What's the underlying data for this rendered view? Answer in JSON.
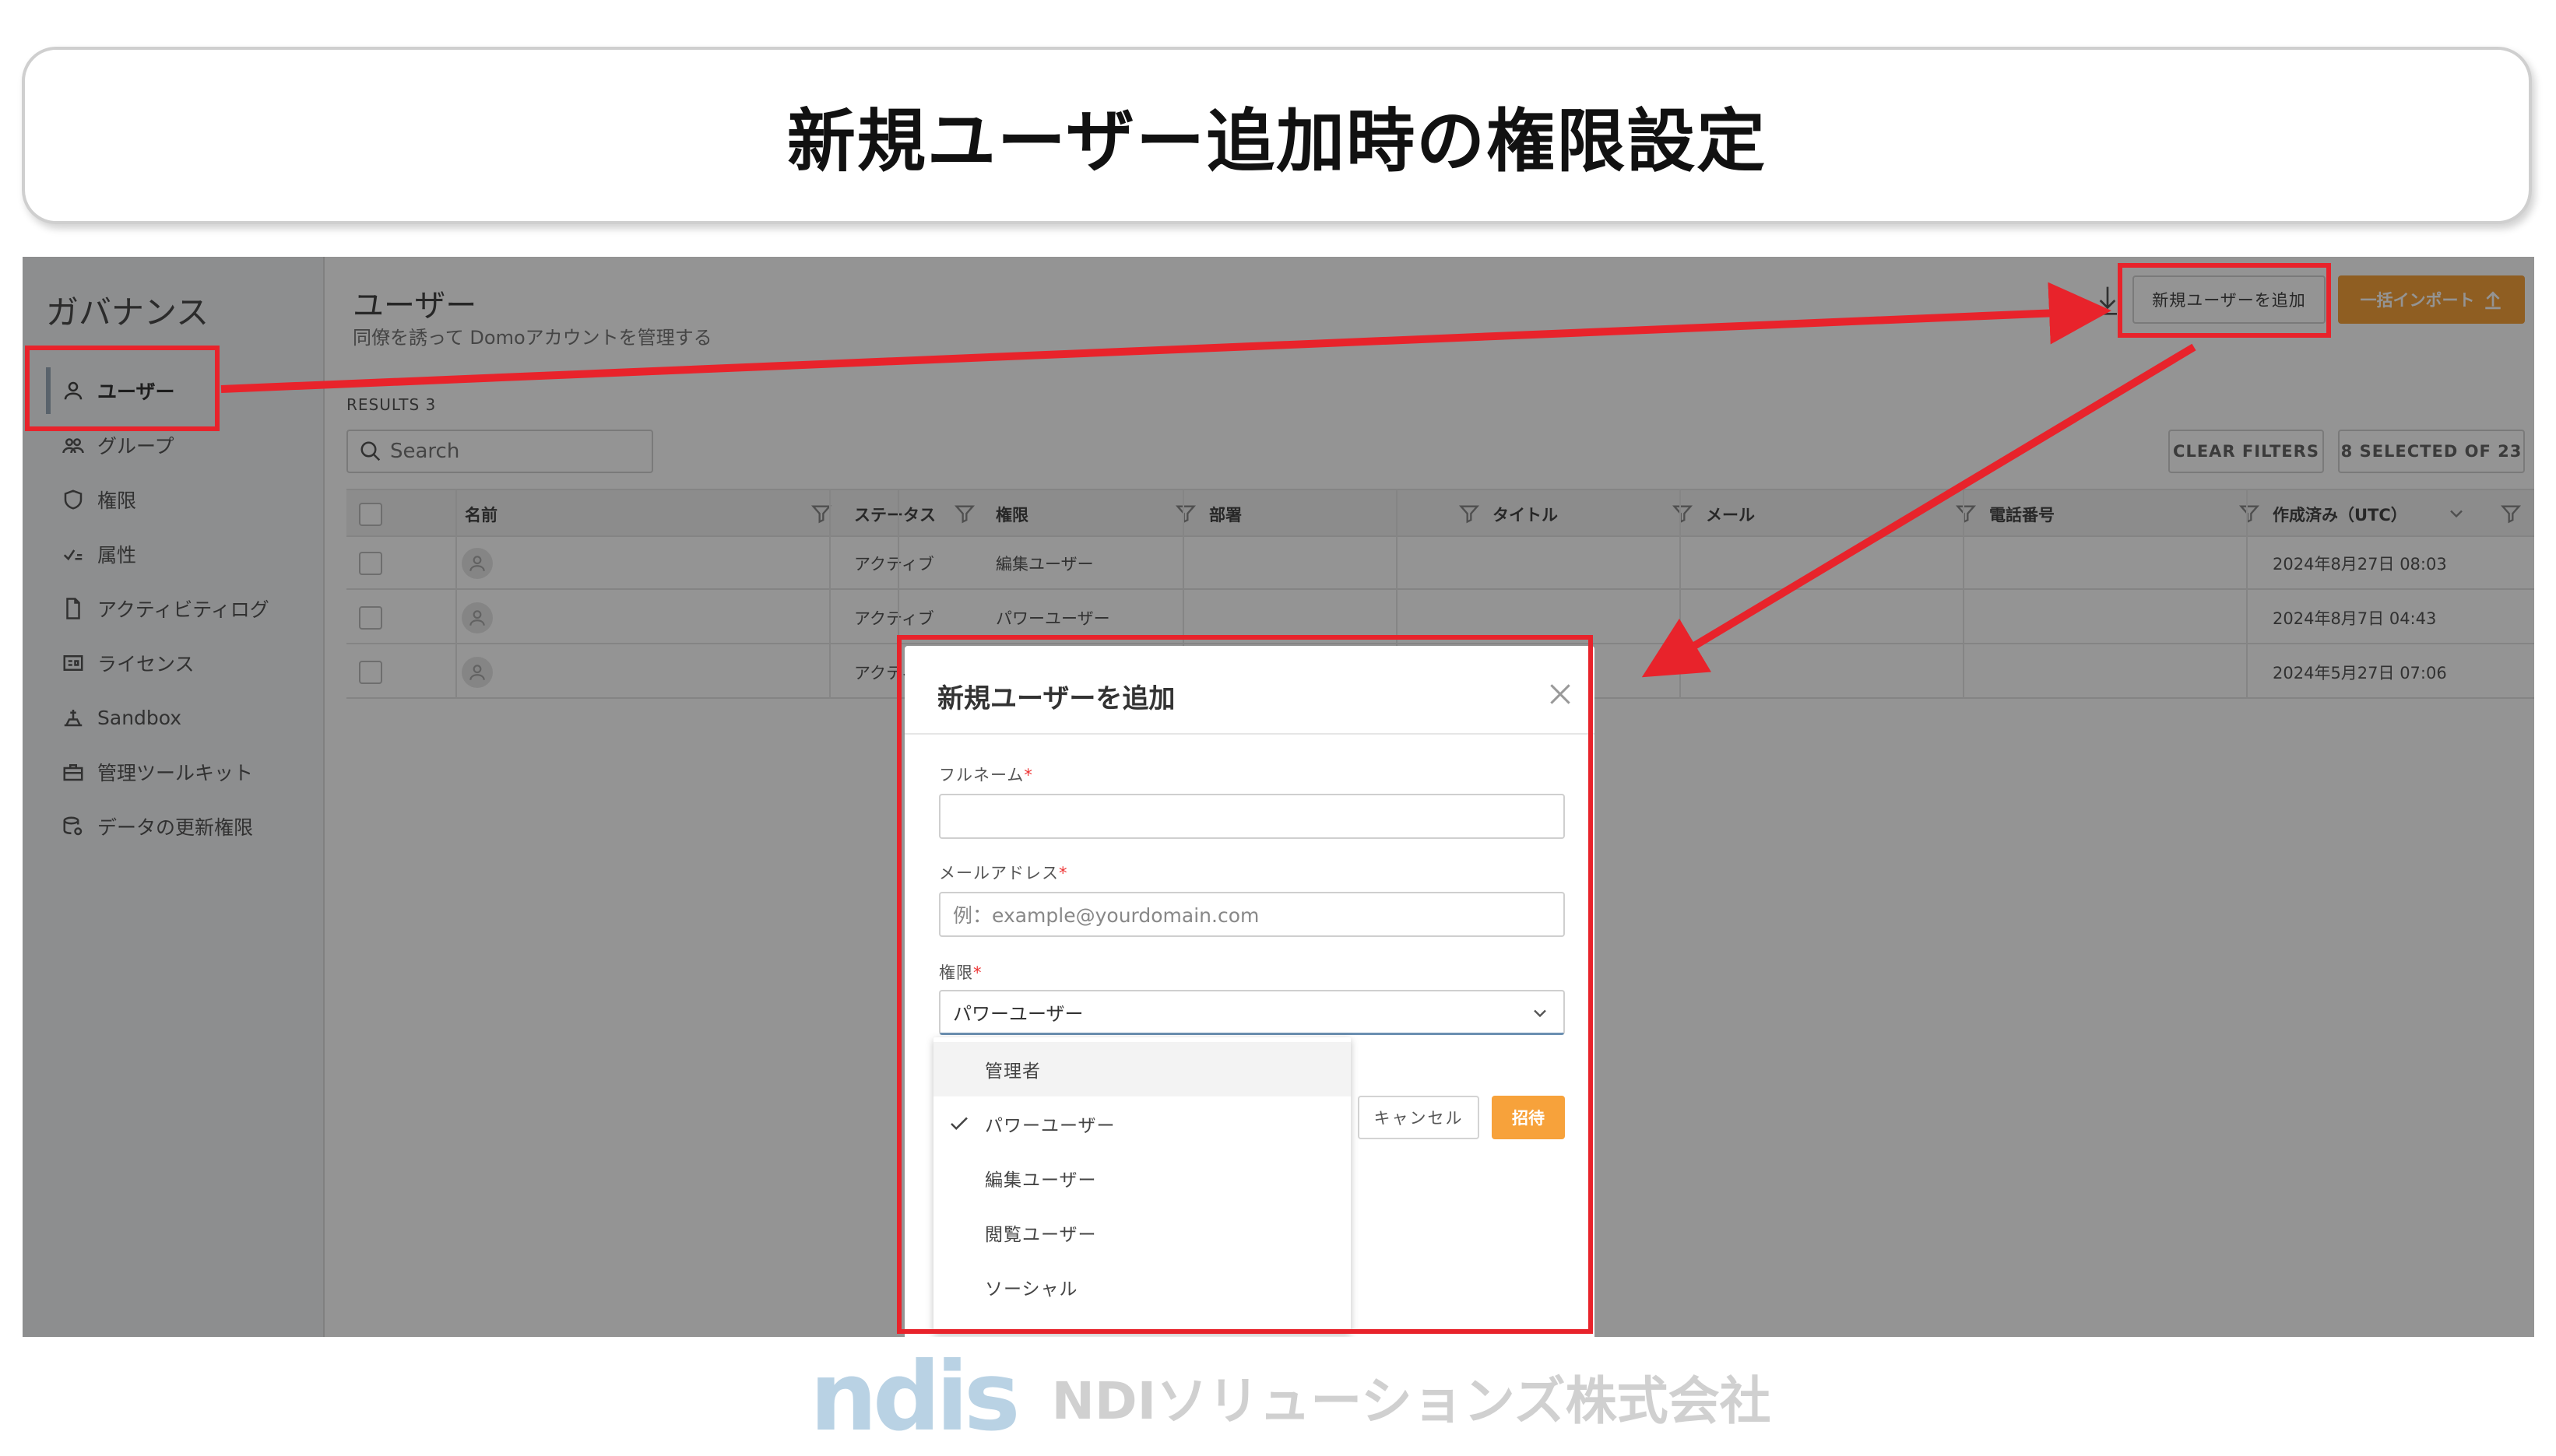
{
  "slide": {
    "title": "新規ユーザー追加時の権限設定",
    "footer_logo": "ndis",
    "footer_company": "NDIソリューションズ株式会社"
  },
  "sidebar": {
    "title": "ガバナンス",
    "items": [
      {
        "label": "ユーザー",
        "icon": "user-icon",
        "active": true
      },
      {
        "label": "グループ",
        "icon": "group-icon",
        "active": false
      },
      {
        "label": "権限",
        "icon": "shield-icon",
        "active": false
      },
      {
        "label": "属性",
        "icon": "attribute-icon",
        "active": false
      },
      {
        "label": "アクティビティログ",
        "icon": "document-icon",
        "active": false
      },
      {
        "label": "ライセンス",
        "icon": "license-icon",
        "active": false
      },
      {
        "label": "Sandbox",
        "icon": "sandbox-icon",
        "active": false
      },
      {
        "label": "管理ツールキット",
        "icon": "toolkit-icon",
        "active": false
      },
      {
        "label": "データの更新権限",
        "icon": "data-permission-icon",
        "active": false
      }
    ]
  },
  "main": {
    "title": "ユーザー",
    "subtitle": "同僚を誘って Domoアカウントを管理する",
    "results_label": "RESULTS 3",
    "search_placeholder": "Search",
    "add_user_button": "新規ユーザーを追加",
    "bulk_import_button": "一括インポート",
    "clear_filters": "CLEAR FILTERS",
    "selected_columns": "8 SELECTED OF 23"
  },
  "table": {
    "columns": [
      "名前",
      "ステータス",
      "権限",
      "部署",
      "タイトル",
      "メール",
      "電話番号",
      "作成済み（UTC）"
    ],
    "rows": [
      {
        "status": "アクティブ",
        "role": "編集ユーザー",
        "created": "2024年8月27日 08:03"
      },
      {
        "status": "アクティブ",
        "role": "パワーユーザー",
        "created": "2024年8月7日 04:43"
      },
      {
        "status": "アクティブ",
        "role": "",
        "created": "2024年5月27日 07:06"
      }
    ]
  },
  "modal": {
    "title": "新規ユーザーを追加",
    "fullname_label": "フルネーム",
    "email_label": "メールアドレス",
    "email_placeholder": "例：example@yourdomain.com",
    "role_label": "権限",
    "required_mark": "*",
    "role_selected": "パワーユーザー",
    "cancel_button": "キャンセル",
    "invite_button": "招待",
    "role_options": [
      {
        "label": "管理者",
        "checked": false,
        "hover": true
      },
      {
        "label": "パワーユーザー",
        "checked": true,
        "hover": false
      },
      {
        "label": "編集ユーザー",
        "checked": false,
        "hover": false
      },
      {
        "label": "閲覧ユーザー",
        "checked": false,
        "hover": false
      },
      {
        "label": "ソーシャル",
        "checked": false,
        "hover": false
      }
    ]
  },
  "colors": {
    "accent_orange": "#f7a23b",
    "annotation_red": "#e8232b",
    "required_red": "#e33333"
  }
}
